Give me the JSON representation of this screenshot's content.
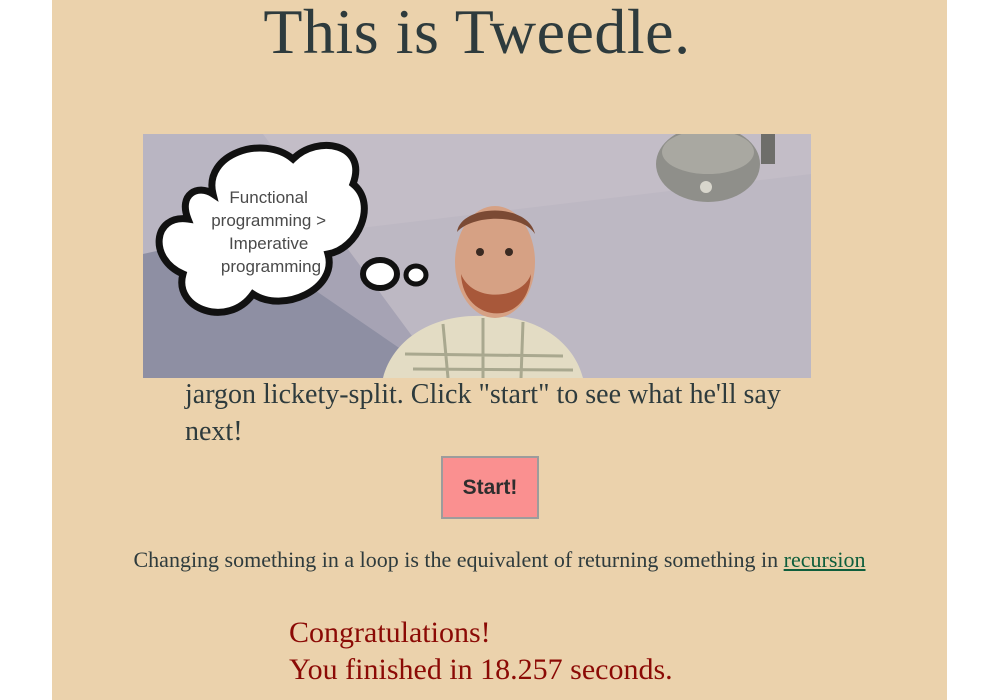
{
  "header": {
    "title": "This is Tweedle."
  },
  "hero": {
    "alt": "Photo of Tweedle with a thought bubble",
    "thought_bubble": {
      "lines": [
        "Functional",
        "programming >",
        "Imperative",
        "programming"
      ]
    }
  },
  "intro": {
    "text": "jargon lickety-split. Click \"start\" to see what he'll say next!"
  },
  "controls": {
    "start_label": "Start!"
  },
  "jargon": {
    "prefix": "Changing something in a loop is the equivalent of returning something in",
    "link_text": "recursion"
  },
  "result": {
    "line1": "Congratulations!",
    "line2": "You finished in 18.257 seconds."
  },
  "colors": {
    "page_background": "#ebd2ac",
    "button_background": "#fa9090",
    "link": "#0e5e3c",
    "congrats": "#8b0a05"
  }
}
